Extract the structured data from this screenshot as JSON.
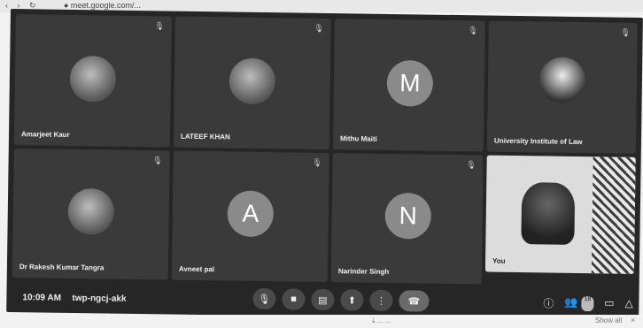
{
  "browser": {
    "nav": "‹ › ↻",
    "url": "● meet.google.com/..."
  },
  "tiles": [
    {
      "name": "Amarjeet Kaur",
      "avatar": ""
    },
    {
      "name": "LATEEF KHAN",
      "avatar": ""
    },
    {
      "name": "Mithu Maiti",
      "avatar": "M"
    },
    {
      "name": "University Institute of Law",
      "avatar": ""
    },
    {
      "name": "Dr Rakesh Kumar Tangra",
      "avatar": ""
    },
    {
      "name": "Avneet pal",
      "avatar": "A"
    },
    {
      "name": "Narinder Singh",
      "avatar": "N"
    },
    {
      "name": "You",
      "avatar": ""
    }
  ],
  "bar": {
    "time": "10:09 AM",
    "meeting_code": "twp-ngcj-akk",
    "participant_count": "18"
  },
  "icons": {
    "mic": "🎙",
    "camera": "■",
    "captions": "▤",
    "present": "⬆",
    "more": "⋮",
    "end_call": "☎",
    "info": "ⓘ",
    "people": "👥",
    "chat": "▭",
    "activities": "△"
  },
  "downloads": {
    "item": "⤓ ... ...",
    "show_all": "Show all",
    "close": "×"
  }
}
